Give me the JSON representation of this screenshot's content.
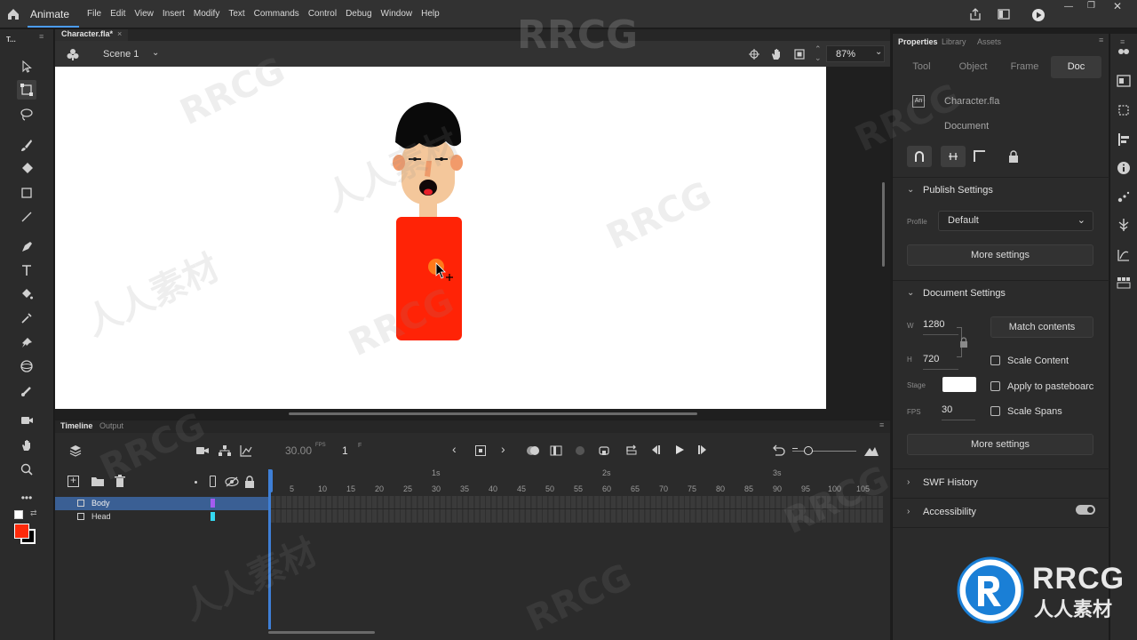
{
  "app": {
    "name": "Animate"
  },
  "menu": [
    "File",
    "Edit",
    "View",
    "Insert",
    "Modify",
    "Text",
    "Commands",
    "Control",
    "Debug",
    "Window",
    "Help"
  ],
  "toolbar": {
    "title": "T..."
  },
  "document": {
    "tab": "Character.fla*",
    "tab_close": "×"
  },
  "scene": {
    "name": "Scene 1",
    "zoom": "87%"
  },
  "timeline": {
    "tabs": [
      "Timeline",
      "Output"
    ],
    "fps": "30.00",
    "fps_unit": "FPS",
    "frame": "1",
    "frame_unit": "F",
    "seconds": [
      "1s",
      "2s",
      "3s"
    ],
    "ticks": [
      "5",
      "10",
      "15",
      "20",
      "25",
      "30",
      "35",
      "40",
      "45",
      "50",
      "55",
      "60",
      "65",
      "70",
      "75",
      "80",
      "85",
      "90",
      "95",
      "100",
      "105"
    ],
    "layers": [
      {
        "name": "Body",
        "color": "#a45cf0",
        "selected": true
      },
      {
        "name": "Head",
        "color": "#34d8f0",
        "selected": false
      }
    ]
  },
  "properties": {
    "panel_tabs": [
      "Properties",
      "Library",
      "Assets"
    ],
    "tabs": [
      "Tool",
      "Object",
      "Frame",
      "Doc"
    ],
    "active_tab": "Doc",
    "doc_name": "Character.fla",
    "doc_type": "Document",
    "publish": {
      "title": "Publish Settings",
      "profile_label": "Profile",
      "profile": "Default",
      "more": "More settings"
    },
    "doc_settings": {
      "title": "Document Settings",
      "w_label": "W",
      "width": "1280",
      "h_label": "H",
      "height": "720",
      "match": "Match contents",
      "stage_label": "Stage",
      "stage_color": "#ffffff",
      "fps_label": "FPS",
      "fps": "30",
      "scale_content": "Scale Content",
      "apply_paste": "Apply to pasteboarc",
      "scale_spans": "Scale Spans",
      "more": "More settings"
    },
    "swf_history": "SWF History",
    "accessibility": "Accessibility"
  },
  "colors": {
    "fill": "#ff2a0a",
    "stroke": "#000000",
    "accent": "#4b9cf5"
  },
  "watermark": {
    "logo_text": "RRCG",
    "logo_sub": "人人素材"
  }
}
